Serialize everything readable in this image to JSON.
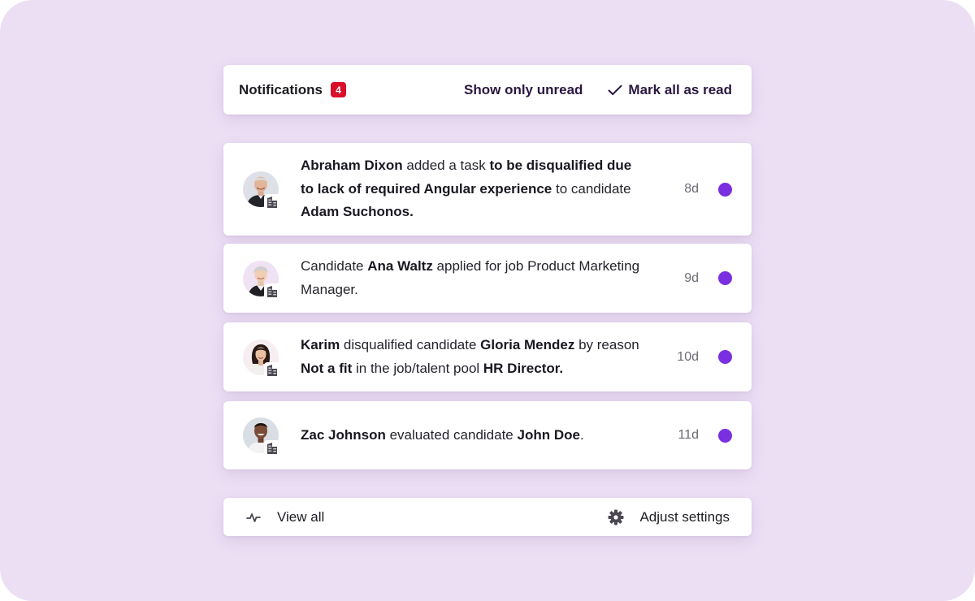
{
  "header": {
    "title": "Notifications",
    "unread_count": "4",
    "show_unread_label": "Show only unread",
    "mark_all_label": "Mark all as read"
  },
  "colors": {
    "background": "#ecdff4",
    "badge": "#d8102a",
    "unread_dot": "#7a2fe0",
    "link_text": "#2a1740"
  },
  "notifications": [
    {
      "icon": "building-icon",
      "parts": [
        {
          "text": "Abraham Dixon",
          "bold": true
        },
        {
          "text": " added a task ",
          "bold": false
        },
        {
          "text": "to be disqualified due to lack of required Angular experience",
          "bold": true
        },
        {
          "text": " to candidate ",
          "bold": false
        },
        {
          "text": "Adam Suchonos.",
          "bold": true
        }
      ],
      "time": "8d",
      "unread": true
    },
    {
      "icon": "building-icon",
      "parts": [
        {
          "text": "Candidate ",
          "bold": false
        },
        {
          "text": "Ana Waltz",
          "bold": true
        },
        {
          "text": " applied for job Product Marketing Manager.",
          "bold": false
        }
      ],
      "time": "9d",
      "unread": true
    },
    {
      "icon": "building-icon",
      "parts": [
        {
          "text": "Karim",
          "bold": true
        },
        {
          "text": " disqualified candidate ",
          "bold": false
        },
        {
          "text": "Gloria Mendez",
          "bold": true
        },
        {
          "text": " by reason ",
          "bold": false
        },
        {
          "text": "Not a fit",
          "bold": true
        },
        {
          "text": " in the job/talent pool ",
          "bold": false
        },
        {
          "text": "HR Director.",
          "bold": true
        }
      ],
      "time": "10d",
      "unread": true
    },
    {
      "icon": "building-icon",
      "parts": [
        {
          "text": "Zac Johnson",
          "bold": true
        },
        {
          "text": " evaluated candidate ",
          "bold": false
        },
        {
          "text": "John Doe",
          "bold": true
        },
        {
          "text": ".",
          "bold": false
        }
      ],
      "time": "11d",
      "unread": true
    }
  ],
  "footer": {
    "view_all_label": "View all",
    "view_all_icon": "activity-icon",
    "settings_label": "Adjust settings",
    "settings_icon": "gear-icon"
  }
}
